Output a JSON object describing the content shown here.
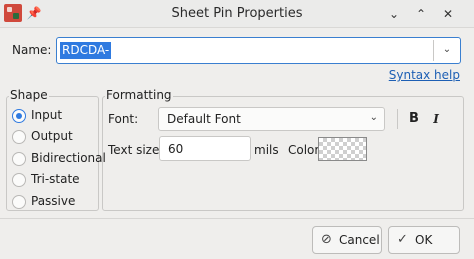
{
  "window": {
    "title": "Sheet Pin Properties",
    "pin_glyph": "📌",
    "minimize_glyph": "⌄",
    "maximize_glyph": "⌃",
    "close_glyph": "✕"
  },
  "name": {
    "label": "Name:",
    "value": "RDCDA-",
    "dropdown_glyph": "⌄"
  },
  "syntax_help": "Syntax help",
  "shape": {
    "title": "Shape",
    "options": [
      {
        "label": "Input",
        "checked": true
      },
      {
        "label": "Output",
        "checked": false
      },
      {
        "label": "Bidirectional",
        "checked": false
      },
      {
        "label": "Tri-state",
        "checked": false
      },
      {
        "label": "Passive",
        "checked": false
      }
    ]
  },
  "formatting": {
    "title": "Formatting",
    "font_label": "Font:",
    "font_value": "Default Font",
    "font_dropdown_glyph": "⌄",
    "bold_label": "B",
    "italic_label": "I",
    "text_size_label": "Text size:",
    "text_size_value": "60",
    "units": "mils",
    "color_label": "Color:"
  },
  "buttons": {
    "cancel_label": "Cancel",
    "cancel_glyph": "⊘",
    "ok_label": "OK",
    "ok_glyph": "✓"
  }
}
